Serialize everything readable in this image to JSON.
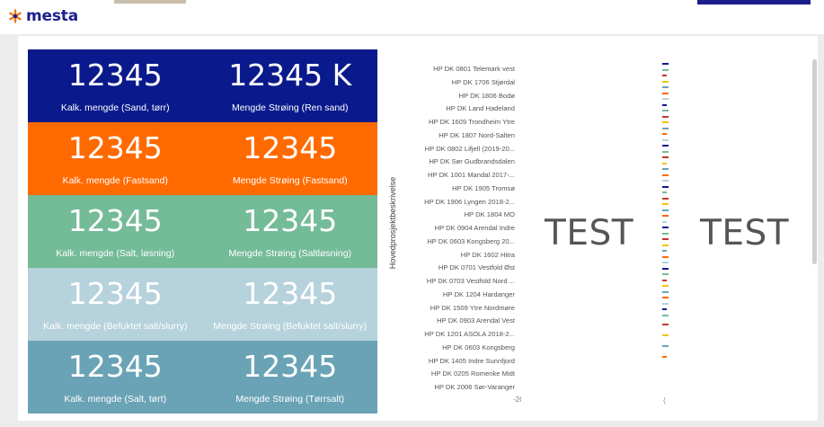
{
  "brand": {
    "name": "mesta",
    "color": "#1a1f8c",
    "star_color": "#f07b1d"
  },
  "tiles": [
    [
      {
        "value": "12345",
        "label": "Kalk. mengde (Sand, tørr)"
      },
      {
        "value": "12345  K",
        "label": "Mengde Strøing (Ren sand)"
      }
    ],
    [
      {
        "value": "12345",
        "label": "Kalk. mengde (Fastsand)"
      },
      {
        "value": "12345",
        "label": "Mengde Strøing (Fastsand)"
      }
    ],
    [
      {
        "value": "12345",
        "label": "Kalk. mengde (Salt, løsning)"
      },
      {
        "value": "12345",
        "label": "Mengde Strøing (Saltløsning)"
      }
    ],
    [
      {
        "value": "12345",
        "label": "Kalk. mengde (Befuktet salt/slurry)"
      },
      {
        "value": "12345",
        "label": "Mengde Strøing (Befuktet salt/slurry)"
      }
    ],
    [
      {
        "value": "12345",
        "label": "Kalk. mengde (Salt, tørt)"
      },
      {
        "value": "12345",
        "label": "Mengde Strøing (Tørrsalt)"
      }
    ]
  ],
  "tile_colors": [
    "#0a1a8c",
    "#ff6a00",
    "#74bb98",
    "#b6d2dc",
    "#6aa3b6"
  ],
  "chart": {
    "y_title": "Hovedprosjektbeskrivelse",
    "x_tick": "-2C",
    "categories": [
      "HP DK 0801 Telemark vest",
      "HP DK 1706 Stjørdal",
      "HP DK 1806 Bodø",
      "HP DK Land Hadeland",
      "HP DK 1609 Trondheim Ytre",
      "HP DK 1807 Nord-Salten",
      "HP DK 0802 Lifjell (2019-20...",
      "HP DK Sør Gudbrandsdalen",
      "HP DK 1001 Mandal 2017-...",
      "HP DK 1905 Tromsø",
      "HP DK 1906 Lyngen 2018-2...",
      "HP DK 1804 MO",
      "HP DK 0904 Arendal Indre",
      "HP DK 0603 Kongsberg 20...",
      "HP DK 1602 Hitra",
      "HP DK 0701 Vestfold Øst",
      "HP DK 0703 Vestfold Nord ...",
      "HP DK 1204 Hardanger",
      "HP DK 1509 Ytre Nordmøre",
      "HP DK 0903 Arendal Vest",
      "HP DK 1201 ASOLA 2018-2...",
      "HP DK 0603 Kongsberg",
      "HP DK 1405 Indre Sunnfjord",
      "HP DK 0205 Romerike Midt",
      "HP DK 2006 Sør-Varanger"
    ]
  },
  "panels": {
    "test_left": "TEST",
    "test_right": "TEST",
    "small_tick": "{"
  }
}
